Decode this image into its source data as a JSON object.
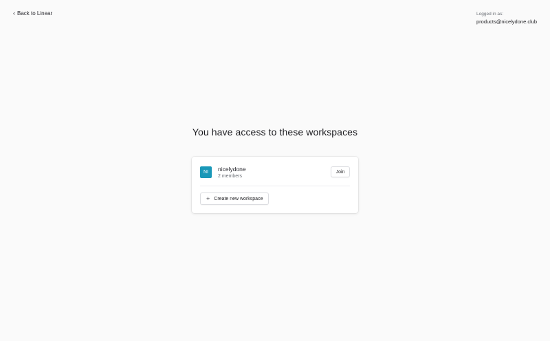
{
  "header": {
    "back_label": "Back to Linear",
    "back_icon": "chevron-left-icon",
    "login_label": "Logged in as:",
    "login_email": "products@nicelydone.club"
  },
  "main": {
    "heading": "You have access to these workspaces",
    "workspaces": [
      {
        "initials": "NI",
        "name": "nicelydone",
        "members": "2 members",
        "avatar_color": "#1a98b8",
        "join_label": "Join"
      }
    ],
    "create_label": "Create new workspace",
    "create_icon": "plus-icon"
  }
}
